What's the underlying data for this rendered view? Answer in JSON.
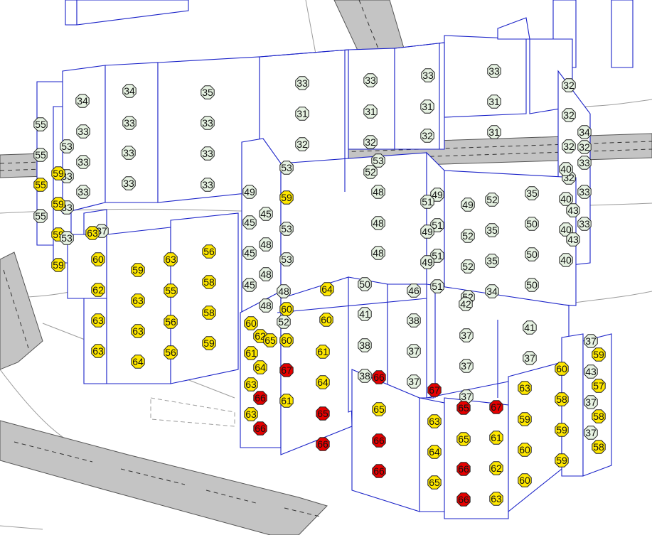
{
  "map": {
    "title": "",
    "level_colors": {
      "quiet": "#e6f2e2",
      "moderate": "#ffe800",
      "loud": "#e60000",
      "outline": "#222222",
      "building_outline": "#1a22c8",
      "road_fill": "#c4c4c4"
    },
    "noise_points": [
      {
        "value": 34,
        "level": "quiet"
      },
      {
        "value": 34,
        "level": "quiet"
      },
      {
        "value": 35,
        "level": "quiet"
      },
      {
        "value": 33,
        "level": "quiet"
      },
      {
        "value": 33,
        "level": "quiet"
      },
      {
        "value": 33,
        "level": "quiet"
      },
      {
        "value": 33,
        "level": "quiet"
      },
      {
        "value": 33,
        "level": "quiet"
      },
      {
        "value": 33,
        "level": "quiet"
      },
      {
        "value": 33,
        "level": "quiet"
      },
      {
        "value": 33,
        "level": "quiet"
      },
      {
        "value": 33,
        "level": "quiet"
      },
      {
        "value": 33,
        "level": "quiet"
      },
      {
        "value": 33,
        "level": "quiet"
      },
      {
        "value": 33,
        "level": "quiet"
      },
      {
        "value": 33,
        "level": "quiet"
      },
      {
        "value": 32,
        "level": "quiet"
      },
      {
        "value": 31,
        "level": "quiet"
      },
      {
        "value": 31,
        "level": "quiet"
      },
      {
        "value": 31,
        "level": "quiet"
      },
      {
        "value": 31,
        "level": "quiet"
      },
      {
        "value": 32,
        "level": "quiet"
      },
      {
        "value": 32,
        "level": "quiet"
      },
      {
        "value": 32,
        "level": "quiet"
      },
      {
        "value": 31,
        "level": "quiet"
      },
      {
        "value": 32,
        "level": "quiet"
      },
      {
        "value": 34,
        "level": "quiet"
      },
      {
        "value": 32,
        "level": "quiet"
      },
      {
        "value": 32,
        "level": "quiet"
      },
      {
        "value": 33,
        "level": "quiet"
      },
      {
        "value": 32,
        "level": "quiet"
      },
      {
        "value": 40,
        "level": "quiet"
      },
      {
        "value": 33,
        "level": "quiet"
      },
      {
        "value": 40,
        "level": "quiet"
      },
      {
        "value": 43,
        "level": "quiet"
      },
      {
        "value": 33,
        "level": "quiet"
      },
      {
        "value": 40,
        "level": "quiet"
      },
      {
        "value": 43,
        "level": "quiet"
      },
      {
        "value": 40,
        "level": "quiet"
      },
      {
        "value": 55,
        "level": "quiet"
      },
      {
        "value": 55,
        "level": "quiet"
      },
      {
        "value": 53,
        "level": "quiet"
      },
      {
        "value": 33,
        "level": "quiet"
      },
      {
        "value": 55,
        "level": "moderate"
      },
      {
        "value": 59,
        "level": "moderate"
      },
      {
        "value": 33,
        "level": "quiet"
      },
      {
        "value": 59,
        "level": "moderate"
      },
      {
        "value": 59,
        "level": "moderate"
      },
      {
        "value": 55,
        "level": "quiet"
      },
      {
        "value": 53,
        "level": "quiet"
      },
      {
        "value": 59,
        "level": "moderate"
      },
      {
        "value": 53,
        "level": "quiet"
      },
      {
        "value": 59,
        "level": "moderate"
      },
      {
        "value": 53,
        "level": "quiet"
      },
      {
        "value": 53,
        "level": "quiet"
      },
      {
        "value": 53,
        "level": "quiet"
      },
      {
        "value": 48,
        "level": "quiet"
      },
      {
        "value": 48,
        "level": "quiet"
      },
      {
        "value": 48,
        "level": "quiet"
      },
      {
        "value": 49,
        "level": "quiet"
      },
      {
        "value": 45,
        "level": "quiet"
      },
      {
        "value": 45,
        "level": "quiet"
      },
      {
        "value": 45,
        "level": "quiet"
      },
      {
        "value": 45,
        "level": "quiet"
      },
      {
        "value": 48,
        "level": "quiet"
      },
      {
        "value": 48,
        "level": "quiet"
      },
      {
        "value": 48,
        "level": "quiet"
      },
      {
        "value": 48,
        "level": "quiet"
      },
      {
        "value": 52,
        "level": "quiet"
      },
      {
        "value": 52,
        "level": "quiet"
      },
      {
        "value": 49,
        "level": "quiet"
      },
      {
        "value": 51,
        "level": "quiet"
      },
      {
        "value": 51,
        "level": "quiet"
      },
      {
        "value": 51,
        "level": "quiet"
      },
      {
        "value": 51,
        "level": "quiet"
      },
      {
        "value": 49,
        "level": "quiet"
      },
      {
        "value": 49,
        "level": "quiet"
      },
      {
        "value": 49,
        "level": "quiet"
      },
      {
        "value": 52,
        "level": "quiet"
      },
      {
        "value": 52,
        "level": "quiet"
      },
      {
        "value": 52,
        "level": "quiet"
      },
      {
        "value": 52,
        "level": "quiet"
      },
      {
        "value": 35,
        "level": "quiet"
      },
      {
        "value": 35,
        "level": "quiet"
      },
      {
        "value": 34,
        "level": "quiet"
      },
      {
        "value": 35,
        "level": "quiet"
      },
      {
        "value": 50,
        "level": "quiet"
      },
      {
        "value": 50,
        "level": "quiet"
      },
      {
        "value": 50,
        "level": "quiet"
      },
      {
        "value": 50,
        "level": "quiet"
      },
      {
        "value": 46,
        "level": "quiet"
      },
      {
        "value": 42,
        "level": "quiet"
      },
      {
        "value": 41,
        "level": "quiet"
      },
      {
        "value": 41,
        "level": "quiet"
      },
      {
        "value": 38,
        "level": "quiet"
      },
      {
        "value": 38,
        "level": "quiet"
      },
      {
        "value": 38,
        "level": "quiet"
      },
      {
        "value": 37,
        "level": "quiet"
      },
      {
        "value": 37,
        "level": "quiet"
      },
      {
        "value": 37,
        "level": "quiet"
      },
      {
        "value": 37,
        "level": "quiet"
      },
      {
        "value": 37,
        "level": "quiet"
      },
      {
        "value": 37,
        "level": "quiet"
      },
      {
        "value": 37,
        "level": "quiet"
      },
      {
        "value": 43,
        "level": "quiet"
      },
      {
        "value": 37,
        "level": "quiet"
      },
      {
        "value": 37,
        "level": "quiet"
      },
      {
        "value": 37,
        "level": "quiet"
      },
      {
        "value": 60,
        "level": "moderate"
      },
      {
        "value": 62,
        "level": "moderate"
      },
      {
        "value": 63,
        "level": "moderate"
      },
      {
        "value": 63,
        "level": "moderate"
      },
      {
        "value": 63,
        "level": "moderate"
      },
      {
        "value": 63,
        "level": "moderate"
      },
      {
        "value": 55,
        "level": "moderate"
      },
      {
        "value": 56,
        "level": "moderate"
      },
      {
        "value": 56,
        "level": "moderate"
      },
      {
        "value": 56,
        "level": "moderate"
      },
      {
        "value": 58,
        "level": "moderate"
      },
      {
        "value": 58,
        "level": "moderate"
      },
      {
        "value": 59,
        "level": "moderate"
      },
      {
        "value": 59,
        "level": "moderate"
      },
      {
        "value": 63,
        "level": "moderate"
      },
      {
        "value": 63,
        "level": "moderate"
      },
      {
        "value": 64,
        "level": "moderate"
      },
      {
        "value": 64,
        "level": "moderate"
      },
      {
        "value": 60,
        "level": "moderate"
      },
      {
        "value": 60,
        "level": "moderate"
      },
      {
        "value": 60,
        "level": "moderate"
      },
      {
        "value": 62,
        "level": "moderate"
      },
      {
        "value": 65,
        "level": "moderate"
      },
      {
        "value": 60,
        "level": "moderate"
      },
      {
        "value": 61,
        "level": "moderate"
      },
      {
        "value": 63,
        "level": "moderate"
      },
      {
        "value": 63,
        "level": "moderate"
      },
      {
        "value": 64,
        "level": "moderate"
      },
      {
        "value": 66,
        "level": "loud"
      },
      {
        "value": 66,
        "level": "loud"
      },
      {
        "value": 67,
        "level": "loud"
      },
      {
        "value": 61,
        "level": "moderate"
      },
      {
        "value": 61,
        "level": "moderate"
      },
      {
        "value": 64,
        "level": "moderate"
      },
      {
        "value": 65,
        "level": "loud"
      },
      {
        "value": 66,
        "level": "loud"
      },
      {
        "value": 66,
        "level": "loud"
      },
      {
        "value": 65,
        "level": "moderate"
      },
      {
        "value": 66,
        "level": "loud"
      },
      {
        "value": 66,
        "level": "loud"
      },
      {
        "value": 67,
        "level": "loud"
      },
      {
        "value": 63,
        "level": "moderate"
      },
      {
        "value": 64,
        "level": "moderate"
      },
      {
        "value": 65,
        "level": "moderate"
      },
      {
        "value": 65,
        "level": "loud"
      },
      {
        "value": 65,
        "level": "moderate"
      },
      {
        "value": 66,
        "level": "loud"
      },
      {
        "value": 66,
        "level": "loud"
      },
      {
        "value": 67,
        "level": "loud"
      },
      {
        "value": 61,
        "level": "moderate"
      },
      {
        "value": 62,
        "level": "moderate"
      },
      {
        "value": 63,
        "level": "moderate"
      },
      {
        "value": 63,
        "level": "moderate"
      },
      {
        "value": 59,
        "level": "moderate"
      },
      {
        "value": 60,
        "level": "moderate"
      },
      {
        "value": 60,
        "level": "moderate"
      },
      {
        "value": 60,
        "level": "moderate"
      },
      {
        "value": 58,
        "level": "moderate"
      },
      {
        "value": 59,
        "level": "moderate"
      },
      {
        "value": 59,
        "level": "moderate"
      },
      {
        "value": 59,
        "level": "moderate"
      },
      {
        "value": 57,
        "level": "moderate"
      },
      {
        "value": 58,
        "level": "moderate"
      },
      {
        "value": 58,
        "level": "moderate"
      },
      {
        "value": 58,
        "level": "moderate"
      }
    ]
  }
}
